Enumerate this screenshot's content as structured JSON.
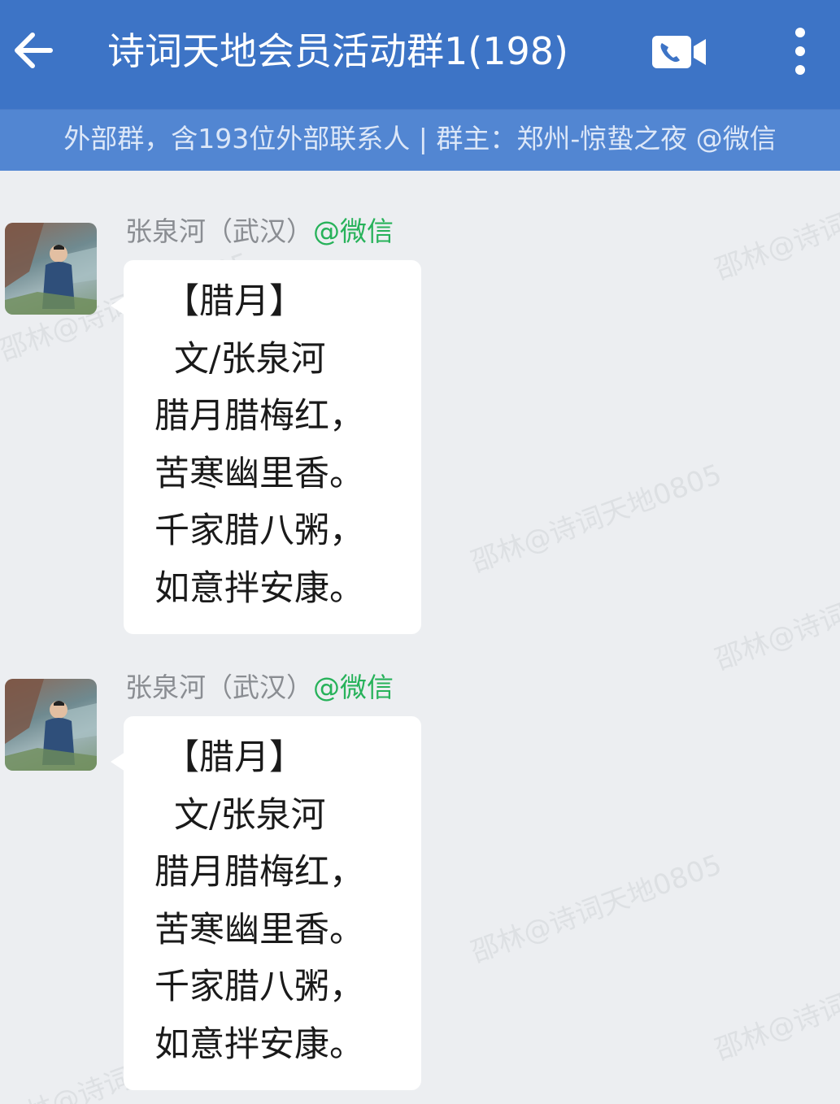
{
  "header": {
    "title": "诗词天地会员活动群1(198)",
    "subinfo": "外部群，含193位外部联系人 | 群主：郑州-惊蛰之夜 @微信",
    "back_icon": "back-arrow-icon",
    "video_icon": "video-call-icon",
    "more_icon": "more-vertical-icon"
  },
  "colors": {
    "header_bg": "#3d74c6",
    "subbar_bg": "#5286d2",
    "chat_bg": "#eceef1",
    "wechat_tag": "#27b25a"
  },
  "messages": [
    {
      "sender": "张泉河（武汉）",
      "tag": "@微信",
      "lines": [
        "【腊月】",
        "文/张泉河",
        "腊月腊梅红，",
        "苦寒幽里香。",
        "千家腊八粥，",
        "如意拌安康。"
      ]
    },
    {
      "sender": "张泉河（武汉）",
      "tag": "@微信",
      "lines": [
        "【腊月】",
        "文/张泉河",
        "腊月腊梅红，",
        "苦寒幽里香。",
        "千家腊八粥，",
        "如意拌安康。"
      ]
    }
  ],
  "watermark": {
    "text": "邵林@诗词天地0805"
  }
}
